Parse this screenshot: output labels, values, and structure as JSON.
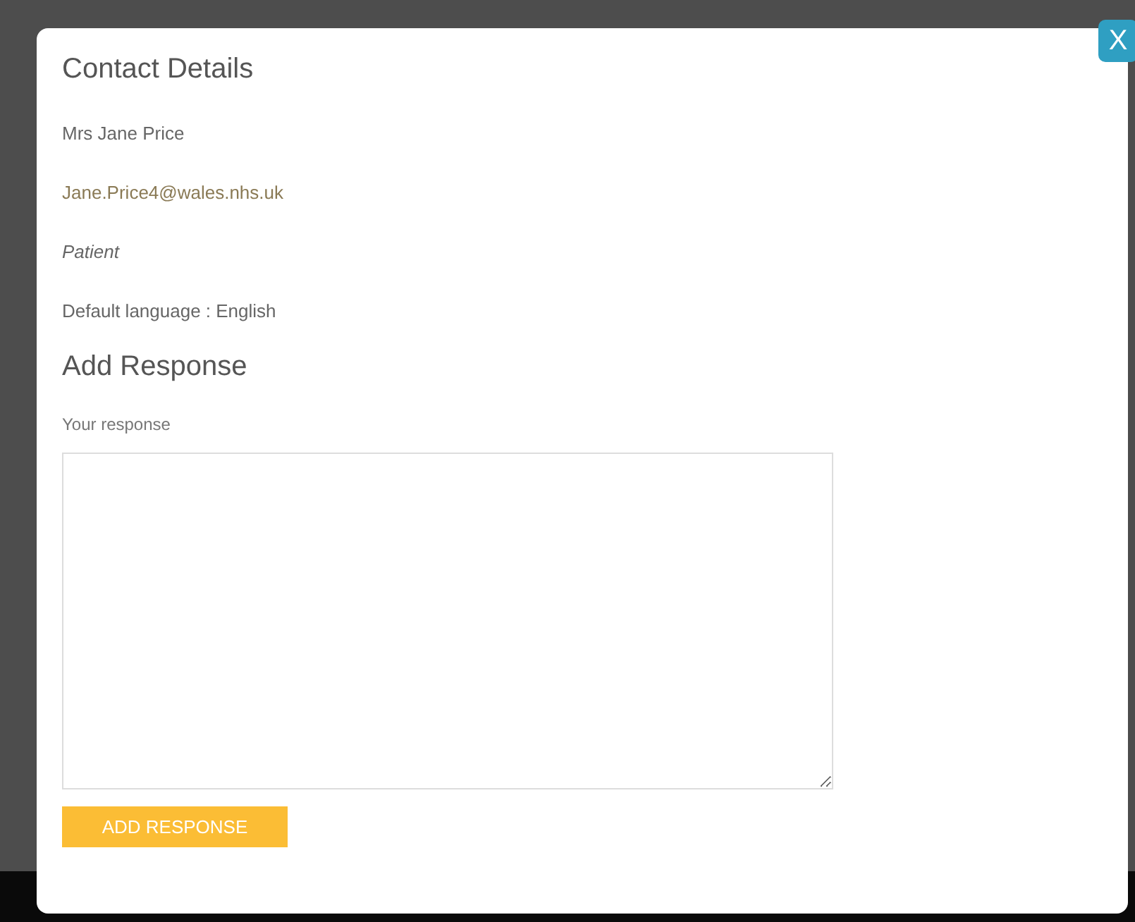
{
  "dialog": {
    "title": "Contact Details",
    "close_label": "X",
    "contact": [
      {
        "kind": "text",
        "text": "Mrs Jane Price"
      },
      {
        "kind": "link",
        "text": "Jane.Price4@wales.nhs.uk"
      },
      {
        "kind": "role",
        "text": "Patient"
      },
      {
        "kind": "text",
        "text": "Default language : English"
      }
    ],
    "response": {
      "heading": "Add Response",
      "label": "Your response",
      "button": "ADD RESPONSE"
    }
  }
}
